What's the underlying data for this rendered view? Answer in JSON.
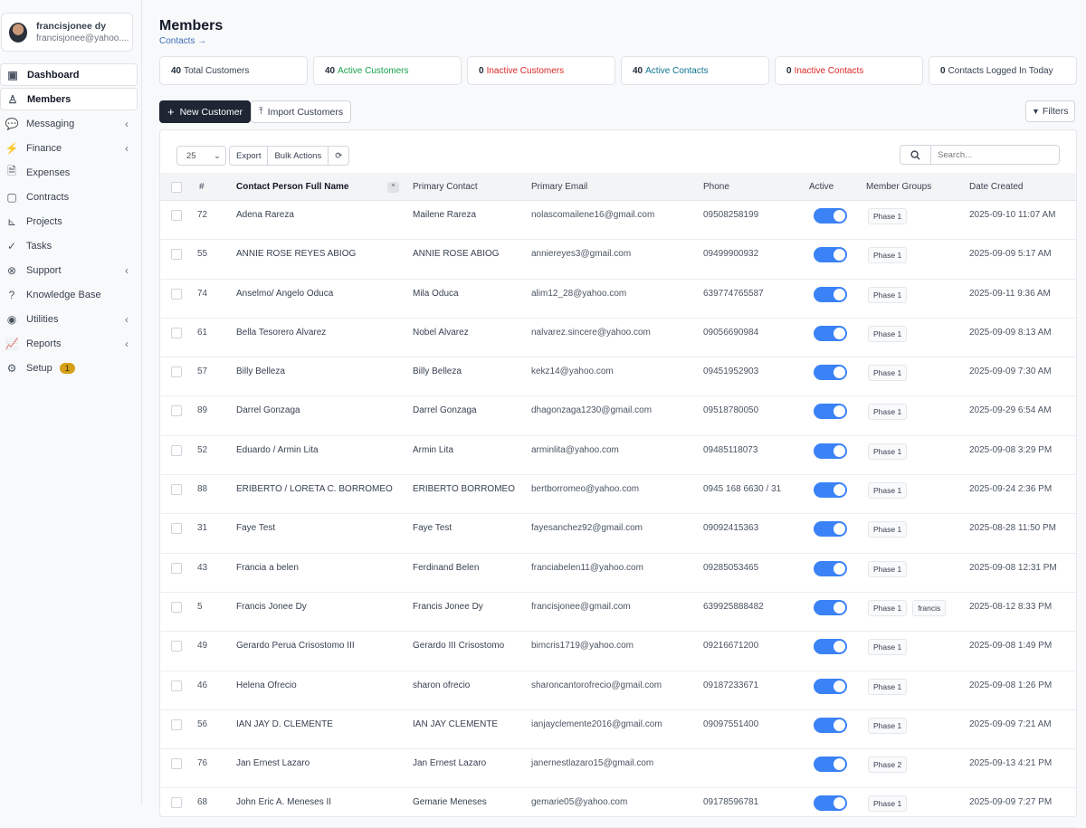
{
  "user": {
    "name": "francisjonee dy",
    "email": "francisjonee@yahoo...."
  },
  "nav": [
    {
      "label": "Dashboard",
      "icon": "dashboard-icon",
      "glyph": "▣",
      "chev": false,
      "active": true
    },
    {
      "label": "Members",
      "icon": "user-icon",
      "glyph": "♙",
      "chev": false,
      "active": true
    },
    {
      "label": "Messaging",
      "icon": "chat-icon",
      "glyph": "💬",
      "chev": true
    },
    {
      "label": "Finance",
      "icon": "bolt-icon",
      "glyph": "⚡",
      "chev": true
    },
    {
      "label": "Expenses",
      "icon": "file-icon",
      "glyph": "🗎",
      "chev": false
    },
    {
      "label": "Contracts",
      "icon": "contract-icon",
      "glyph": "▢",
      "chev": false
    },
    {
      "label": "Projects",
      "icon": "chart-icon",
      "glyph": "⊾",
      "chev": false
    },
    {
      "label": "Tasks",
      "icon": "check-circle-icon",
      "glyph": "✓",
      "chev": false
    },
    {
      "label": "Support",
      "icon": "lifebuoy-icon",
      "glyph": "⊗",
      "chev": true
    },
    {
      "label": "Knowledge Base",
      "icon": "question-icon",
      "glyph": "?",
      "chev": false
    },
    {
      "label": "Utilities",
      "icon": "radio-icon",
      "glyph": "◉",
      "chev": true
    },
    {
      "label": "Reports",
      "icon": "line-chart-icon",
      "glyph": "📈",
      "chev": true
    },
    {
      "label": "Setup",
      "icon": "gear-icon",
      "glyph": "⚙",
      "chev": false,
      "badge": "1"
    }
  ],
  "page": {
    "title": "Members",
    "breadcrumb": "Contacts →"
  },
  "stats": [
    {
      "count": "40",
      "label": "Total Customers",
      "cls": ""
    },
    {
      "count": "40",
      "label": "Active Customers",
      "cls": "green"
    },
    {
      "count": "0",
      "label": "Inactive Customers",
      "cls": "red"
    },
    {
      "count": "40",
      "label": "Active Contacts",
      "cls": "teal"
    },
    {
      "count": "0",
      "label": "Inactive Contacts",
      "cls": "red"
    },
    {
      "count": "0",
      "label": "Contacts Logged In Today",
      "cls": ""
    }
  ],
  "buttons": {
    "new": "New Customer",
    "import": "Import Customers",
    "filters": "Filters"
  },
  "toolbar": {
    "page_size": "25",
    "export": "Export",
    "bulk": "Bulk Actions",
    "search_placeholder": "Search..."
  },
  "columns": [
    "#",
    "Contact Person Full Name",
    "Primary Contact",
    "Primary Email",
    "Phone",
    "Active",
    "Member Groups",
    "Date Created"
  ],
  "rows": [
    {
      "id": "72",
      "name": "Adena Rareza",
      "contact": "Mailene Rareza",
      "email": "nolascomailene16@gmail.com",
      "phone": "09508258199",
      "groups": [
        "Phase 1"
      ],
      "date": "2025-09-10 11:07 AM"
    },
    {
      "id": "55",
      "name": "ANNIE ROSE REYES ABIOG",
      "contact": "ANNIE ROSE ABIOG",
      "email": "anniereyes3@gmail.com",
      "phone": "09499900932",
      "groups": [
        "Phase 1"
      ],
      "date": "2025-09-09 5:17 AM"
    },
    {
      "id": "74",
      "name": "Anselmo/ Angelo Oduca",
      "contact": "Mila Oduca",
      "email": "alim12_28@yahoo.com",
      "phone": "639774765587",
      "groups": [
        "Phase 1"
      ],
      "date": "2025-09-11 9:36 AM"
    },
    {
      "id": "61",
      "name": "Bella Tesorero Alvarez",
      "contact": "Nobel Alvarez",
      "email": "nalvarez.sincere@yahoo.com",
      "phone": "09056690984",
      "groups": [
        "Phase 1"
      ],
      "date": "2025-09-09 8:13 AM"
    },
    {
      "id": "57",
      "name": "Billy Belleza",
      "contact": "Billy Belleza",
      "email": "kekz14@yahoo.com",
      "phone": "09451952903",
      "groups": [
        "Phase 1"
      ],
      "date": "2025-09-09 7:30 AM"
    },
    {
      "id": "89",
      "name": "Darrel Gonzaga",
      "contact": "Darrel Gonzaga",
      "email": "dhagonzaga1230@gmail.com",
      "phone": "09518780050",
      "groups": [
        "Phase 1"
      ],
      "date": "2025-09-29 6:54 AM"
    },
    {
      "id": "52",
      "name": "Eduardo / Armin Lita",
      "contact": "Armin Lita",
      "email": "arminlita@yahoo.com",
      "phone": "09485118073",
      "groups": [
        "Phase 1"
      ],
      "date": "2025-09-08 3:29 PM"
    },
    {
      "id": "88",
      "name": "ERIBERTO / LORETA C. BORROMEO",
      "contact": "ERIBERTO BORROMEO",
      "email": "bertborromeo@yahoo.com",
      "phone": "0945 168 6630 / 31",
      "groups": [
        "Phase 1"
      ],
      "date": "2025-09-24 2:36 PM"
    },
    {
      "id": "31",
      "name": "Faye Test",
      "contact": "Faye Test",
      "email": "fayesanchez92@gmail.com",
      "phone": "09092415363",
      "groups": [
        "Phase 1"
      ],
      "date": "2025-08-28 11:50 PM"
    },
    {
      "id": "43",
      "name": "Francia a belen",
      "contact": "Ferdinand Belen",
      "email": "franciabelen11@yahoo.com",
      "phone": "09285053465",
      "groups": [
        "Phase 1"
      ],
      "date": "2025-09-08 12:31 PM"
    },
    {
      "id": "5",
      "name": "Francis Jonee Dy",
      "contact": "Francis Jonee Dy",
      "email": "francisjonee@gmail.com",
      "phone": "639925888482",
      "groups": [
        "Phase 1",
        "francis"
      ],
      "date": "2025-08-12 8:33 PM"
    },
    {
      "id": "49",
      "name": "Gerardo Perua Crisostomo III",
      "contact": "Gerardo III Crisostomo",
      "email": "bimcris1719@yahoo.com",
      "phone": "09216671200",
      "groups": [
        "Phase 1"
      ],
      "date": "2025-09-08 1:49 PM"
    },
    {
      "id": "46",
      "name": "Helena Ofrecio",
      "contact": "sharon ofrecio",
      "email": "sharoncantorofrecio@gmail.com",
      "phone": "09187233671",
      "groups": [
        "Phase 1"
      ],
      "date": "2025-09-08 1:26 PM"
    },
    {
      "id": "56",
      "name": "IAN JAY D. CLEMENTE",
      "contact": "IAN JAY CLEMENTE",
      "email": "ianjayclemente2016@gmail.com",
      "phone": "09097551400",
      "groups": [
        "Phase 1"
      ],
      "date": "2025-09-09 7:21 AM"
    },
    {
      "id": "76",
      "name": "Jan Ernest Lazaro",
      "contact": "Jan Ernest Lazaro",
      "email": "janernestlazaro15@gmail.com",
      "phone": "",
      "groups": [
        "Phase 2"
      ],
      "date": "2025-09-13 4:21 PM"
    },
    {
      "id": "68",
      "name": "John Eric A. Meneses II",
      "contact": "Gemarie Meneses",
      "email": "gemarie05@yahoo.com",
      "phone": "09178596781",
      "groups": [
        "Phase 1"
      ],
      "date": "2025-09-09 7:27 PM"
    }
  ]
}
